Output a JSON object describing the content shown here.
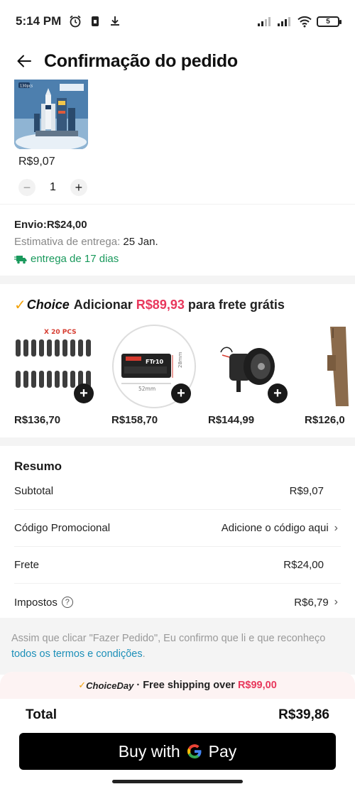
{
  "status_bar": {
    "time": "5:14 PM",
    "battery": "5",
    "icons": [
      "alarm-icon",
      "sim-icon",
      "download-icon",
      "signal-icon",
      "signal-icon",
      "wifi-icon",
      "battery-icon"
    ]
  },
  "header": {
    "title": "Confirmação do pedido",
    "back_icon": "arrow-left-icon"
  },
  "product": {
    "image_label": "130pcs",
    "price": "R$9,07",
    "quantity": "1",
    "minus": "−",
    "plus": "+"
  },
  "shipping": {
    "price": "Envio:R$24,00",
    "estimate_label": "Estimativa de entrega: ",
    "estimate_date": "25 Jan.",
    "days": "entrega de 17 dias"
  },
  "choice": {
    "logo": "Choice",
    "text_before": "Adicionar",
    "amount": "R$89,93",
    "text_after": "para frete grátis",
    "items": [
      {
        "price": "R$136,70",
        "tag": "X 20 PCS"
      },
      {
        "price": "R$158,70",
        "tag": "FTr10",
        "dim_w": "52mm",
        "dim_h": "28mm"
      },
      {
        "price": "R$144,99"
      },
      {
        "price": "R$126,0"
      }
    ]
  },
  "summary": {
    "title": "Resumo",
    "rows": [
      {
        "label": "Subtotal",
        "value": "R$9,07"
      },
      {
        "label": "Código Promocional",
        "value": "Adicione o código aqui"
      },
      {
        "label": "Frete",
        "value": "R$24,00"
      },
      {
        "label": "Impostos",
        "value": "R$6,79"
      }
    ]
  },
  "terms": {
    "text": "Assim que clicar \"Fazer Pedido\", Eu confirmo que li e que reconheço ",
    "link": "todos os termos e condições",
    "end": "."
  },
  "bottom": {
    "promo_logo": "ChoiceDay",
    "promo_text": "· Free shipping over",
    "promo_amount": "R$99,00",
    "total_label": "Total",
    "total_value": "R$39,86",
    "pay_text": "Buy with",
    "pay_brand": "Pay"
  },
  "colors": {
    "accent_red": "#e8385c",
    "choice_orange": "#f2a20a",
    "delivery_green": "#19995c",
    "link_blue": "#1c8fb8"
  }
}
